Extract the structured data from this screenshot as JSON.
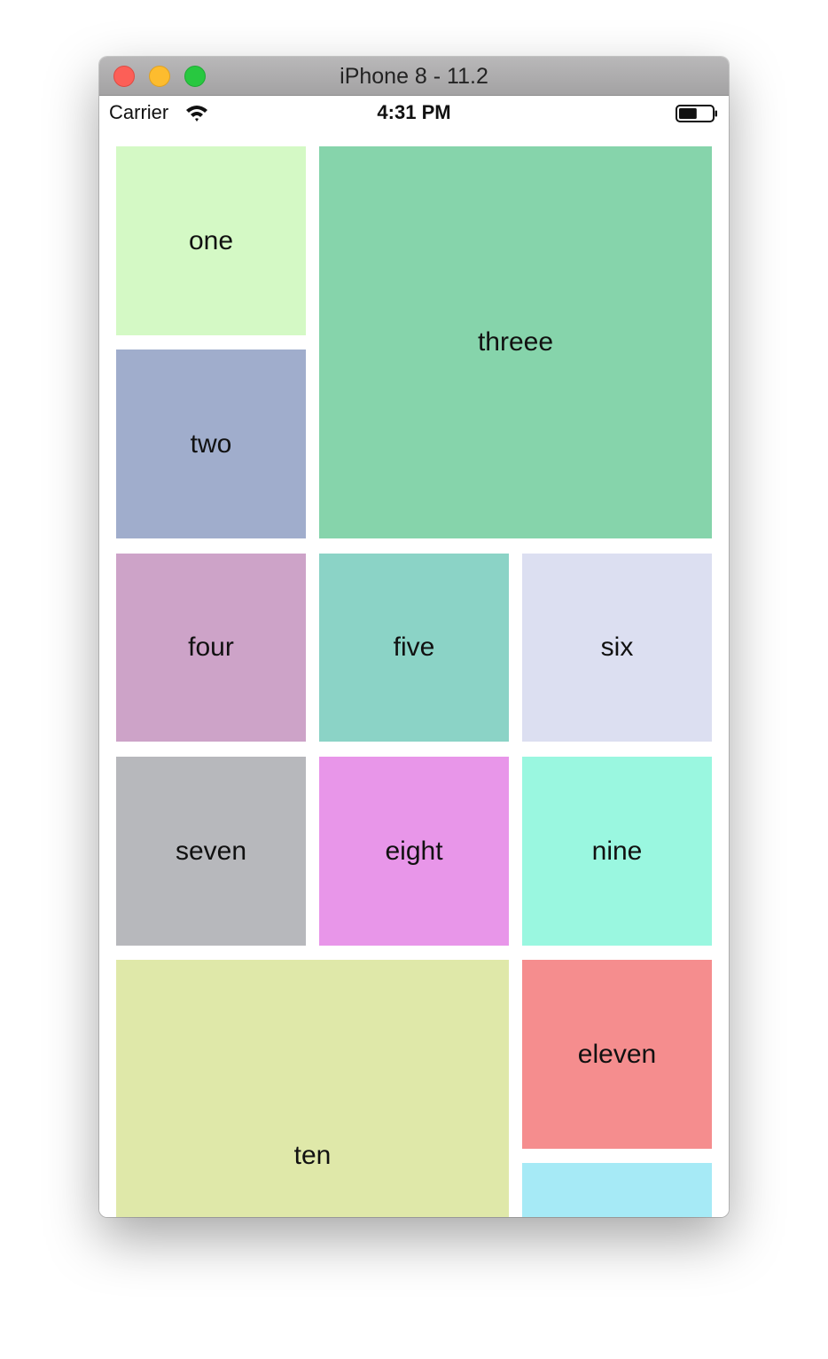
{
  "window": {
    "title": "iPhone 8 - 11.2"
  },
  "status_bar": {
    "carrier": "Carrier",
    "time": "4:31 PM",
    "wifi_icon": "wifi-icon",
    "battery_icon": "battery-icon",
    "battery_level": 0.55
  },
  "tiles": [
    {
      "label": "one",
      "color": "#d4f9c5"
    },
    {
      "label": "two",
      "color": "#a0adcc"
    },
    {
      "label": "threee",
      "color": "#86d4ab"
    },
    {
      "label": "four",
      "color": "#cda3c8"
    },
    {
      "label": "five",
      "color": "#8bd3c6"
    },
    {
      "label": "six",
      "color": "#dcdff1"
    },
    {
      "label": "seven",
      "color": "#b7b8bc"
    },
    {
      "label": "eight",
      "color": "#e896e9"
    },
    {
      "label": "nine",
      "color": "#9af7e0"
    },
    {
      "label": "ten",
      "color": "#dfe8a9"
    },
    {
      "label": "eleven",
      "color": "#f58d8e"
    },
    {
      "label": "",
      "color": "#a6eaf6"
    }
  ]
}
